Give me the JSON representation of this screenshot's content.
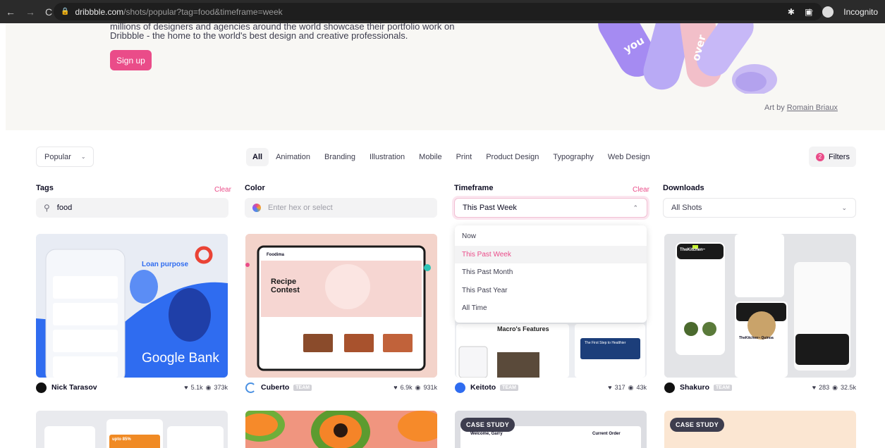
{
  "browser": {
    "domain": "dribbble.com",
    "path": "/shots/popular?tag=food&timeframe=week",
    "incognito_label": "Incognito"
  },
  "hero": {
    "partial_line": "millions of designers and agencies around the world showcase their portfolio work on",
    "line": "Dribbble - the home to the world's best design and creative professionals.",
    "signup_label": "Sign up",
    "art_by_prefix": "Art by",
    "art_by_name": "Romain Briaux"
  },
  "filter_bar": {
    "sort_label": "Popular",
    "categories": [
      "All",
      "Animation",
      "Branding",
      "Illustration",
      "Mobile",
      "Print",
      "Product Design",
      "Typography",
      "Web Design"
    ],
    "filters_label": "Filters",
    "filters_count": "2"
  },
  "fields": {
    "tags": {
      "label": "Tags",
      "clear": "Clear",
      "value": "food"
    },
    "color": {
      "label": "Color",
      "placeholder": "Enter hex or select"
    },
    "timeframe": {
      "label": "Timeframe",
      "clear": "Clear",
      "value": "This Past Week"
    },
    "downloads": {
      "label": "Downloads",
      "value": "All Shots"
    }
  },
  "timeframe_options": [
    "Now",
    "This Past Week",
    "This Past Month",
    "This Past Year",
    "All Time"
  ],
  "timeframe_selected": "This Past Week",
  "shots": [
    {
      "author": "Nick Tarasov",
      "team": "",
      "likes": "5.1k",
      "views": "373k",
      "caption": "Google Bank",
      "sub": "Loan purpose"
    },
    {
      "author": "Cuberto",
      "team": "TEAM",
      "likes": "6.9k",
      "views": "931k",
      "caption": "Recipe Contest",
      "sub": "Foodima"
    },
    {
      "author": "Keitoto",
      "team": "TEAM",
      "likes": "317",
      "views": "43k",
      "caption": "Macro's Features",
      "sub": "The First Step to Healthier"
    },
    {
      "author": "Shakuro",
      "team": "TEAM",
      "likes": "283",
      "views": "32.5k",
      "caption": "TheKitchen~",
      "sub": "TheKitchen~ Quinoa"
    }
  ],
  "second_row": [
    {
      "badge": "",
      "text": "upto 85%"
    },
    {
      "badge": "",
      "text": ""
    },
    {
      "badge": "CASE STUDY",
      "text": "Welcome, Garry",
      "text2": "Current Order"
    },
    {
      "badge": "CASE STUDY",
      "text": ""
    }
  ],
  "colors": {
    "accent": "#ea4c89",
    "dark": "#0d0c22",
    "muted": "#6e6d7a"
  }
}
